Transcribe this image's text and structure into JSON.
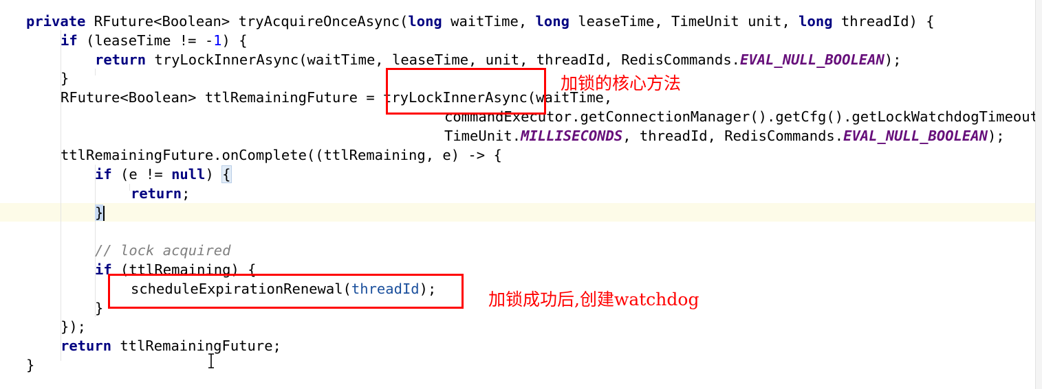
{
  "code": {
    "l1": {
      "kw1": "private",
      "t1": " RFuture<Boolean> tryAcquireOnceAsync(",
      "kw2": "long",
      "t2": " waitTime, ",
      "kw3": "long",
      "t3": " leaseTime, TimeUnit unit, ",
      "kw4": "long",
      "t4": " threadId) {"
    },
    "l2": {
      "kw": "if",
      "t1": " (leaseTime != -",
      "num": "1",
      "t2": ") {"
    },
    "l3": {
      "kw": "return",
      "t1": " tryLockInnerAsync(waitTime, leaseTime, unit, threadId, RedisCommands.",
      "field": "EVAL_NULL_BOOLEAN",
      "t2": ");"
    },
    "l4": {
      "t": "}"
    },
    "l5": {
      "t": "RFuture<Boolean> ttlRemainingFuture = tryLockInnerAsync(waitTime,"
    },
    "l6": {
      "t": "commandExecutor.getConnectionManager().getCfg().getLockWatchdogTimeout(),"
    },
    "l7": {
      "t1": "TimeUnit.",
      "field1": "MILLISECONDS",
      "t2": ", threadId, RedisCommands.",
      "field2": "EVAL_NULL_BOOLEAN",
      "t3": ");"
    },
    "l8": {
      "t": "ttlRemainingFuture.onComplete((ttlRemaining, e) -> {"
    },
    "l9": {
      "kw1": "if",
      "t1": " (e != ",
      "kw2": "null",
      "t2": ") ",
      "brace": "{"
    },
    "l10": {
      "kw": "return",
      "t": ";"
    },
    "l11": {
      "brace": "}"
    },
    "l12": {
      "comment": "// lock acquired"
    },
    "l13": {
      "kw": "if",
      "t": " (ttlRemaining) {"
    },
    "l14": {
      "t1": "scheduleExpirationRenewal(",
      "param": "threadId",
      "t2": ");"
    },
    "l15": {
      "t": "}"
    },
    "l16": {
      "t": "});"
    },
    "l17": {
      "kw": "return",
      "t": " ttlRemainingFuture;"
    },
    "l18": {
      "t": "}"
    }
  },
  "annotations": {
    "a1": "加锁的核心方法",
    "a2": "加锁成功后,创建watchdog"
  },
  "colors": {
    "keyword": "#000080",
    "static_field": "#660e7a",
    "parameter": "#1a4f9c",
    "comment": "#808080",
    "annotation": "#ff0000",
    "caret_line": "#fdfbe8"
  }
}
